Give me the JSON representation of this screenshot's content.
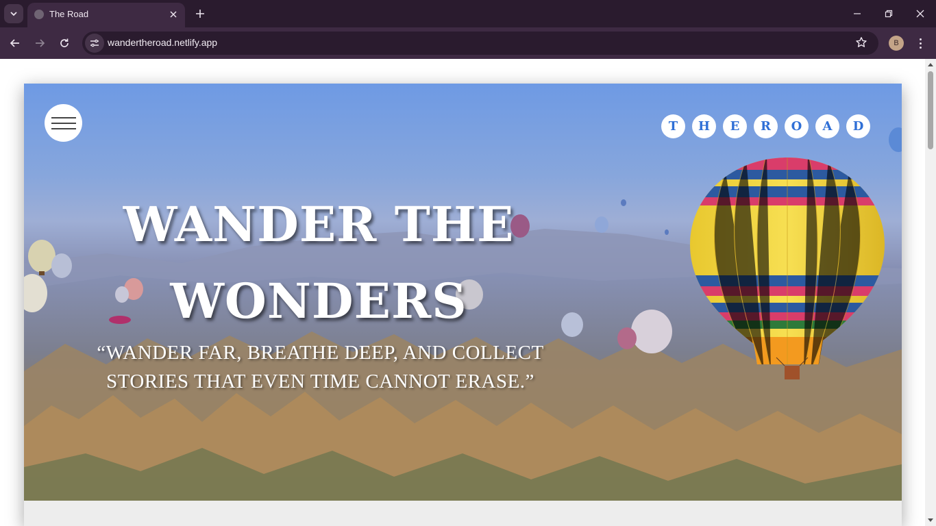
{
  "browser": {
    "tab_title": "The Road",
    "url": "wandertheroad.netlify.app",
    "profile_initial": "B"
  },
  "page": {
    "brand_letters": [
      "T",
      "H",
      "E",
      "R",
      "O",
      "A",
      "D"
    ],
    "hero_title_line1": "WANDER THE",
    "hero_title_line2": "WONDERS",
    "quote_line1": "“WANDER FAR, BREATHE DEEP, AND COLLECT",
    "quote_line2": "STORIES THAT EVEN TIME CANNOT ERASE.”"
  },
  "icons": {
    "tab_search": "chevron-down-icon",
    "new_tab": "plus-icon",
    "back": "arrow-left-icon",
    "forward": "arrow-right-icon",
    "reload": "reload-icon",
    "site_info": "tune-icon",
    "bookmark": "star-icon",
    "menu": "hamburger-icon"
  },
  "colors": {
    "chrome_dark": "#2a1b2e",
    "chrome_mid": "#3e2a43",
    "brand_blue": "#2f6fd6",
    "balloon_yellow": "#f2d23a"
  }
}
